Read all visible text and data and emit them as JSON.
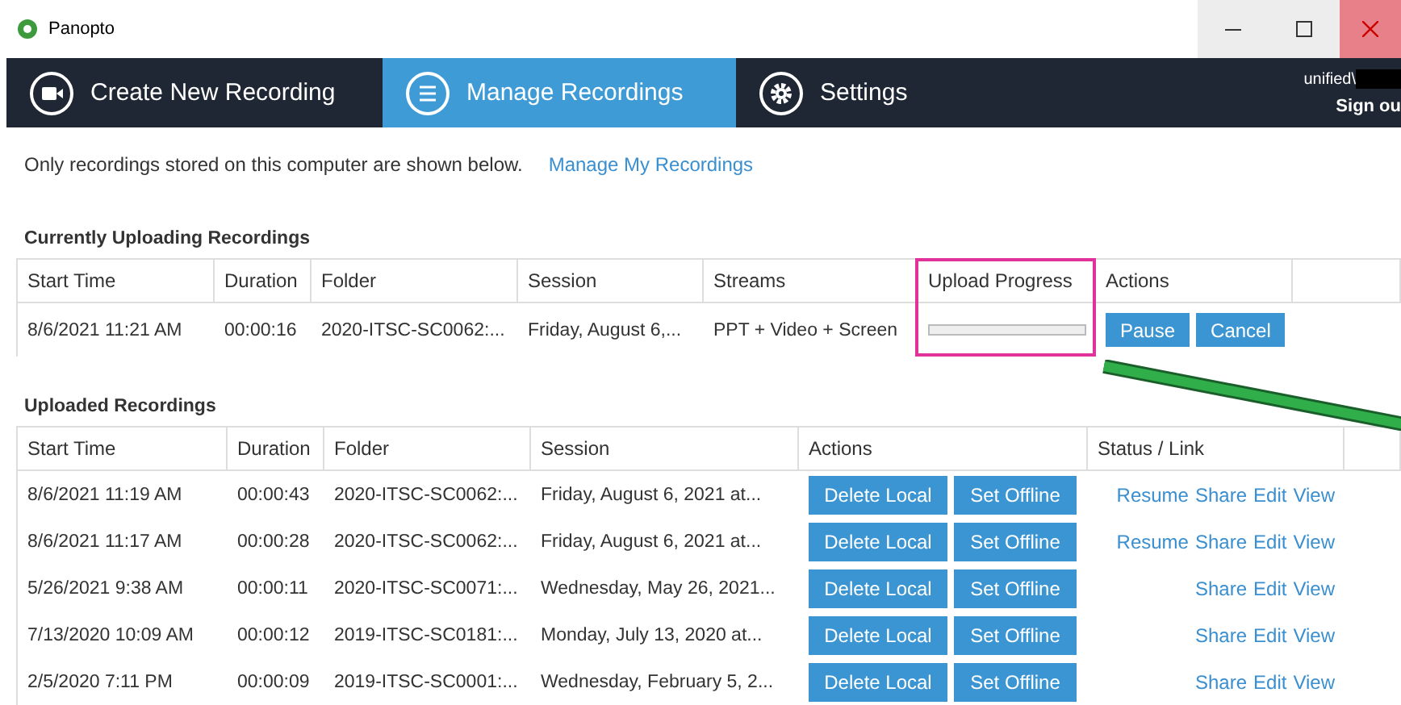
{
  "window": {
    "title": "Panopto"
  },
  "tabs": [
    {
      "label": "Create New Recording",
      "kind": "camera",
      "selected": false
    },
    {
      "label": "Manage Recordings",
      "kind": "list",
      "selected": true
    },
    {
      "label": "Settings",
      "kind": "gear",
      "selected": false
    }
  ],
  "account": {
    "user": "unified\\",
    "sign_out": "Sign ou"
  },
  "intro": {
    "text": "Only recordings stored on this computer are shown below.",
    "link": "Manage My Recordings"
  },
  "uploading": {
    "title": "Currently Uploading Recordings",
    "columns": [
      "Start Time",
      "Duration",
      "Folder",
      "Session",
      "Streams",
      "Upload Progress",
      "Actions"
    ],
    "rows": [
      {
        "start": "8/6/2021 11:21 AM",
        "duration": "00:00:16",
        "folder": "2020-ITSC-SC0062:...",
        "session": "Friday, August 6,...",
        "streams": "PPT + Video + Screen",
        "level": 0,
        "buttons": [
          "Pause",
          "Cancel"
        ]
      }
    ]
  },
  "uploaded": {
    "title": "Uploaded Recordings",
    "columns": [
      "Start Time",
      "Duration",
      "Folder",
      "Session",
      "Actions",
      "Status / Link"
    ],
    "rows": [
      {
        "start": "8/6/2021 11:19 AM",
        "duration": "00:00:43",
        "folder": "2020-ITSC-SC0062:...",
        "session": "Friday, August 6, 2021 at...",
        "buttons": [
          "Delete Local",
          "Set Offline"
        ],
        "links": [
          "Resume",
          "Share",
          "Edit",
          "View"
        ]
      },
      {
        "start": "8/6/2021 11:17 AM",
        "duration": "00:00:28",
        "folder": "2020-ITSC-SC0062:...",
        "session": "Friday, August 6, 2021 at...",
        "buttons": [
          "Delete Local",
          "Set Offline"
        ],
        "links": [
          "Resume",
          "Share",
          "Edit",
          "View"
        ]
      },
      {
        "start": "5/26/2021 9:38 AM",
        "duration": "00:00:11",
        "folder": "2020-ITSC-SC0071:...",
        "session": "Wednesday, May 26, 2021...",
        "buttons": [
          "Delete Local",
          "Set Offline"
        ],
        "links": [
          "Share",
          "Edit",
          "View"
        ]
      },
      {
        "start": "7/13/2020 10:09 AM",
        "duration": "00:00:12",
        "folder": "2019-ITSC-SC0181:...",
        "session": "Monday, July 13, 2020 at...",
        "buttons": [
          "Delete Local",
          "Set Offline"
        ],
        "links": [
          "Share",
          "Edit",
          "View"
        ]
      },
      {
        "start": "2/5/2020 7:11 PM",
        "duration": "00:00:09",
        "folder": "2019-ITSC-SC0001:...",
        "session": "Wednesday, February 5, 2...",
        "buttons": [
          "Delete Local",
          "Set Offline"
        ],
        "links": [
          "Share",
          "Edit",
          "View"
        ]
      }
    ]
  }
}
